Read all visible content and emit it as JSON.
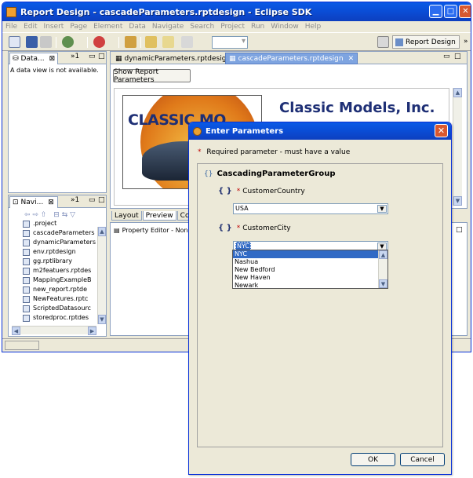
{
  "window": {
    "title": "Report Design - cascadeParameters.rptdesign - Eclipse SDK"
  },
  "menu": [
    "File",
    "Edit",
    "Insert",
    "Page",
    "Element",
    "Data",
    "Navigate",
    "Search",
    "Project",
    "Run",
    "Window",
    "Help"
  ],
  "toolbar": {
    "perspective_label": "Report Design",
    "overflow": "»"
  },
  "data_view": {
    "tab_label": "Data...",
    "tab_close": "⊠",
    "overflow": "»1",
    "message": "A data view is not available."
  },
  "navigator": {
    "tab_label": "Navi...",
    "tab_close": "⊠",
    "overflow": "»1",
    "items": [
      ".project",
      "cascadeParameters",
      "dynamicParameters",
      "env.rptdesign",
      "gg.rptlibrary",
      "m2featuers.rptdes",
      "MappingExampleB",
      "new_report.rptde",
      "NewFeatures.rptc",
      "ScriptedDatasourc",
      "storedproc.rptdes"
    ]
  },
  "editor": {
    "tabs": [
      {
        "label": "dynamicParameters.rptdesign",
        "active": false
      },
      {
        "label": "cascadeParameters.rptdesign",
        "active": true
      }
    ],
    "close_glyph": "✕",
    "show_params_label": "Show Report Parameters",
    "logo_text": "CLASSIC MO",
    "company_name": "Classic Models, Inc.",
    "sub_tabs": [
      "Layout",
      "Preview",
      "Code"
    ]
  },
  "property_editor": {
    "label": "Property Editor - None"
  },
  "dialog": {
    "title": "Enter Parameters",
    "required_note": "Required parameter - must have a value",
    "required_star": "*",
    "group_name": "CascadingParameterGroup",
    "params": [
      {
        "label": "CustomerCountry",
        "value": "USA"
      },
      {
        "label": "CustomerCity",
        "value": "NYC"
      }
    ],
    "city_options": [
      "NYC",
      "Nashua",
      "New Bedford",
      "New Haven",
      "Newark"
    ],
    "ok_label": "OK",
    "cancel_label": "Cancel"
  },
  "colors": {
    "title_blue": "#0a4fd9",
    "selection_blue": "#316ac5",
    "required_red": "#c00000",
    "xp_face": "#ece9d8"
  }
}
